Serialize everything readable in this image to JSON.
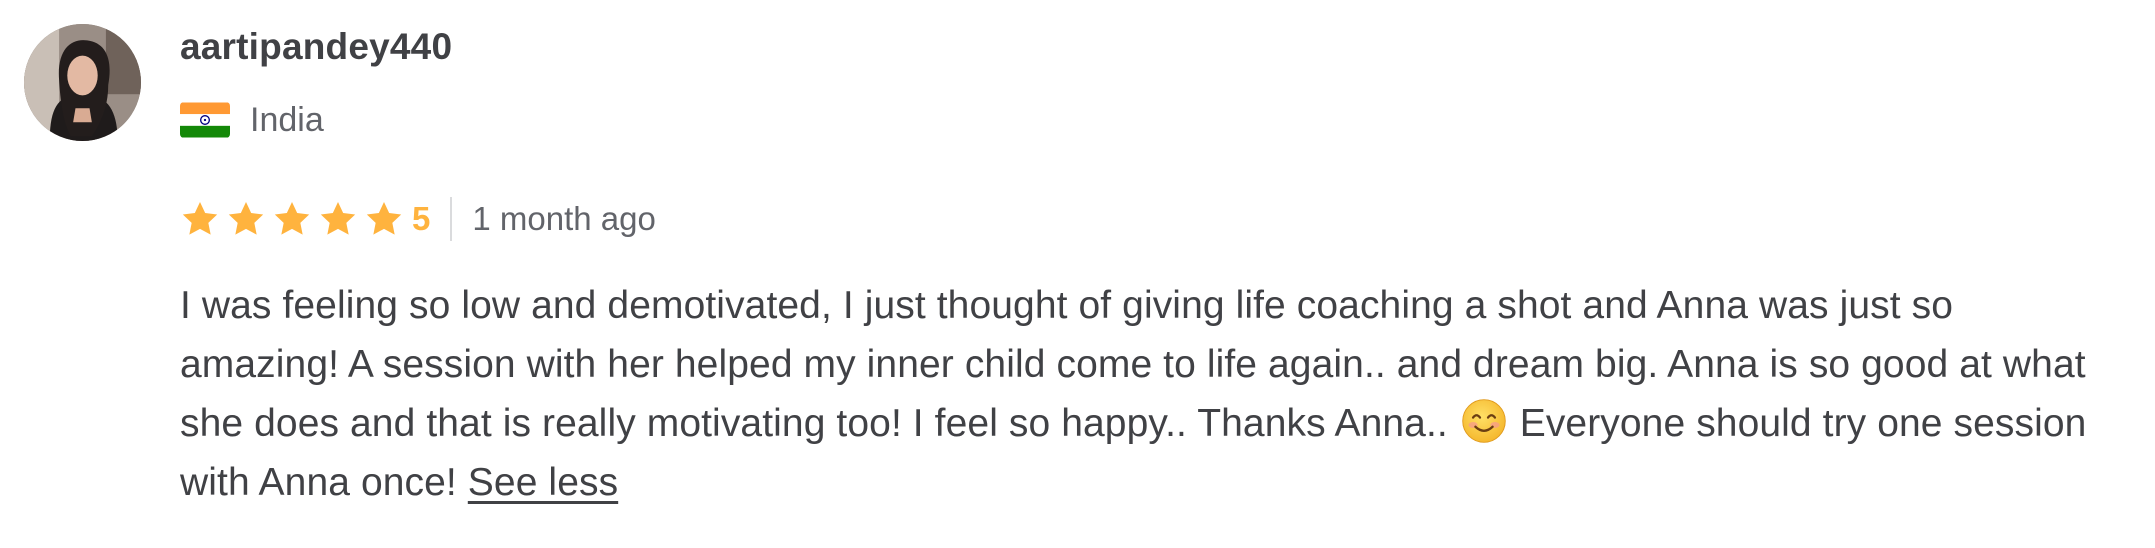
{
  "reviewer": {
    "username": "aartipandey440",
    "avatar_icon": "user-avatar-photo",
    "country": "India",
    "flag_icon": "india-flag-icon"
  },
  "rating": {
    "stars": 5,
    "max_stars": 5,
    "value": "5",
    "star_color": "#ffb33e",
    "time_ago": "1 month ago"
  },
  "review": {
    "text_before_emoji": "I was feeling so low and demotivated, I just thought of giving life coaching a shot and Anna was just so amazing! A session with her helped my inner child come to life again.. and dream big. Anna is so good at what she does and that is really motivating too! I feel so happy.. Thanks Anna.. ",
    "emoji_icon": "smiling-face-emoji-icon",
    "text_after_emoji": " Everyone should try one session with Anna once! ",
    "see_less_label": "See less"
  }
}
